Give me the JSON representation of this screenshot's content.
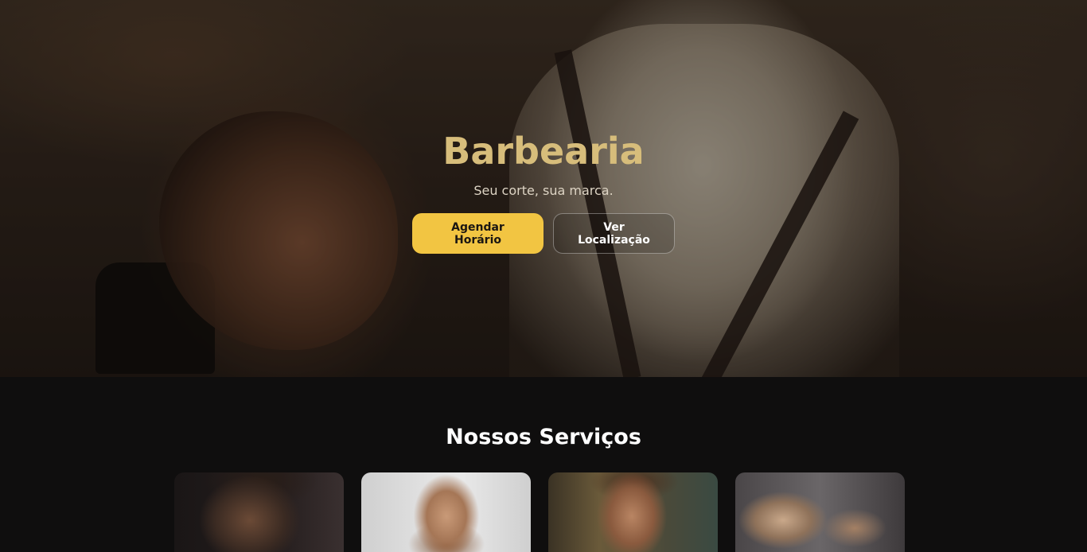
{
  "hero": {
    "title": "Barbearia",
    "subtitle": "Seu corte, sua marca.",
    "primary_button": "Agendar Horário",
    "secondary_button": "Ver Localização"
  },
  "services": {
    "title": "Nossos Serviços",
    "cards": [
      {
        "image": "haircut-fade-photo"
      },
      {
        "image": "beard-grooming-photo"
      },
      {
        "image": "styled-hair-photo"
      },
      {
        "image": "razor-shave-photo"
      }
    ]
  },
  "colors": {
    "accent": "#f2c542",
    "title_gold": "#d7bd7b",
    "background": "#0f0e0e"
  }
}
